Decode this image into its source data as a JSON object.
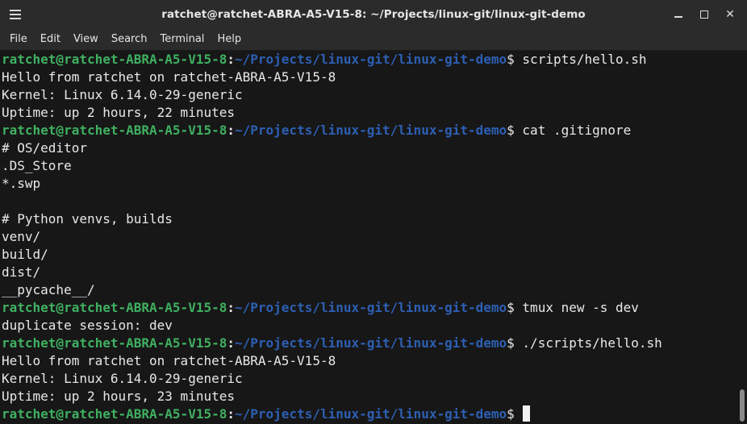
{
  "window": {
    "title": "ratchet@ratchet-ABRA-A5-V15-8: ~/Projects/linux-git/linux-git-demo"
  },
  "menubar": {
    "items": [
      "File",
      "Edit",
      "View",
      "Search",
      "Terminal",
      "Help"
    ]
  },
  "prompt": {
    "user_host": "ratchet@ratchet-ABRA-A5-V15-8",
    "colon": ":",
    "path": "~/Projects/linux-git/linux-git-demo",
    "dollar": "$ "
  },
  "terminal": {
    "lines": [
      {
        "type": "prompt",
        "command": "scripts/hello.sh"
      },
      {
        "type": "output",
        "text": "Hello from ratchet on ratchet-ABRA-A5-V15-8"
      },
      {
        "type": "output",
        "text": "Kernel: Linux 6.14.0-29-generic"
      },
      {
        "type": "output",
        "text": "Uptime: up 2 hours, 22 minutes"
      },
      {
        "type": "prompt",
        "command": "cat .gitignore"
      },
      {
        "type": "output",
        "text": "# OS/editor"
      },
      {
        "type": "output",
        "text": ".DS_Store"
      },
      {
        "type": "output",
        "text": "*.swp"
      },
      {
        "type": "output",
        "text": ""
      },
      {
        "type": "output",
        "text": "# Python venvs, builds"
      },
      {
        "type": "output",
        "text": "venv/"
      },
      {
        "type": "output",
        "text": "build/"
      },
      {
        "type": "output",
        "text": "dist/"
      },
      {
        "type": "output",
        "text": "__pycache__/"
      },
      {
        "type": "prompt",
        "command": "tmux new -s dev"
      },
      {
        "type": "output",
        "text": "duplicate session: dev"
      },
      {
        "type": "prompt",
        "command": "./scripts/hello.sh"
      },
      {
        "type": "output",
        "text": "Hello from ratchet on ratchet-ABRA-A5-V15-8"
      },
      {
        "type": "output",
        "text": "Kernel: Linux 6.14.0-29-generic"
      },
      {
        "type": "output",
        "text": "Uptime: up 2 hours, 23 minutes"
      },
      {
        "type": "prompt",
        "command": "",
        "cursor": true
      }
    ]
  },
  "colors": {
    "prompt_user": "#3fb061",
    "prompt_path": "#2d5fb3",
    "background": "#171717",
    "foreground": "#e8e8e8"
  },
  "icons": {
    "menu": "hamburger-icon",
    "minimize": "minimize-icon",
    "maximize": "maximize-icon",
    "close": "close-icon"
  },
  "window_controls": {
    "close_glyph": "✕"
  }
}
